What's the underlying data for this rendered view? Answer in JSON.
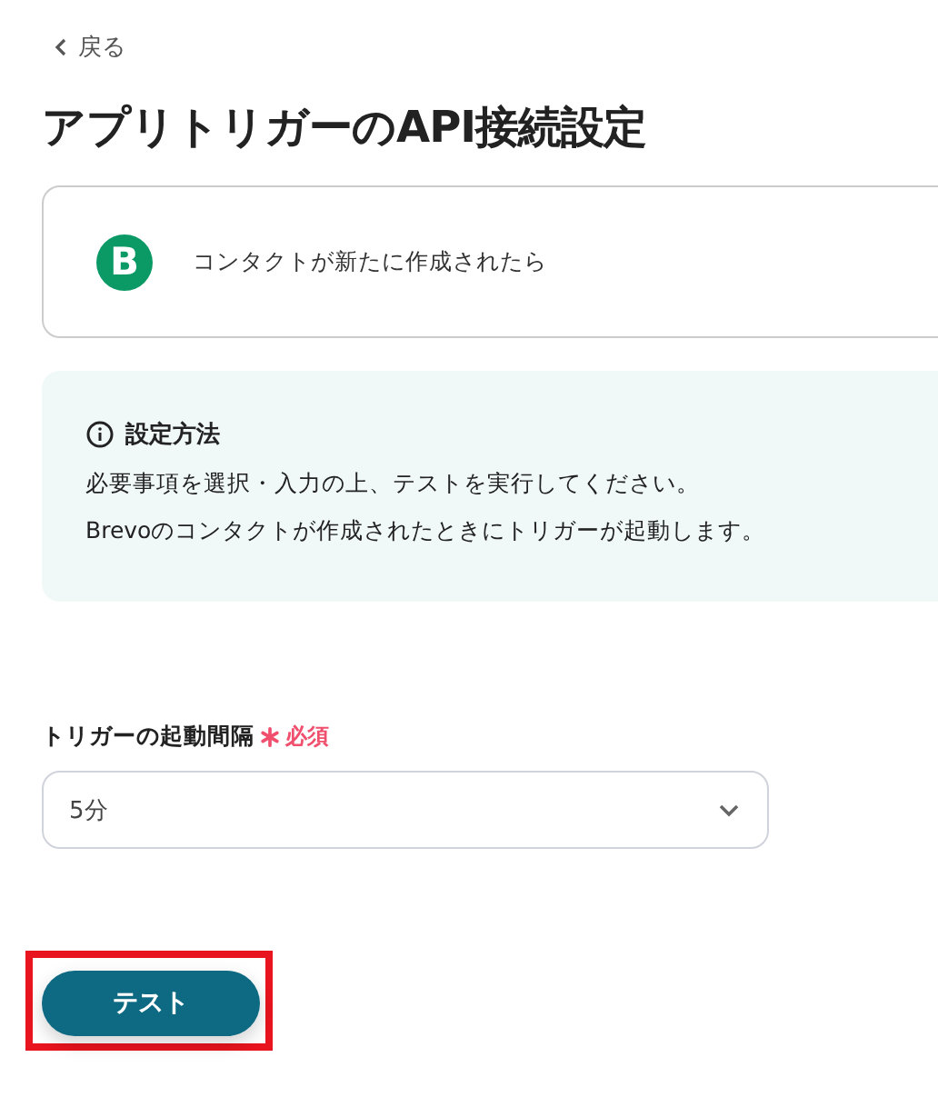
{
  "back_link": {
    "label": "戻る"
  },
  "title": "アプリトリガーのAPI接続設定",
  "trigger_card": {
    "app_letter": "B",
    "label": "コンタクトが新たに作成されたら"
  },
  "info_box": {
    "heading": "設定方法",
    "lines": [
      "必要事項を選択・入力の上、テストを実行してください。",
      "Brevoのコンタクトが作成されたときにトリガーが起動します。"
    ]
  },
  "interval_field": {
    "label": "トリガーの起動間隔",
    "required": true,
    "required_label": "必須",
    "value": "5分"
  },
  "test_button": {
    "label": "テスト",
    "highlighted": true
  }
}
